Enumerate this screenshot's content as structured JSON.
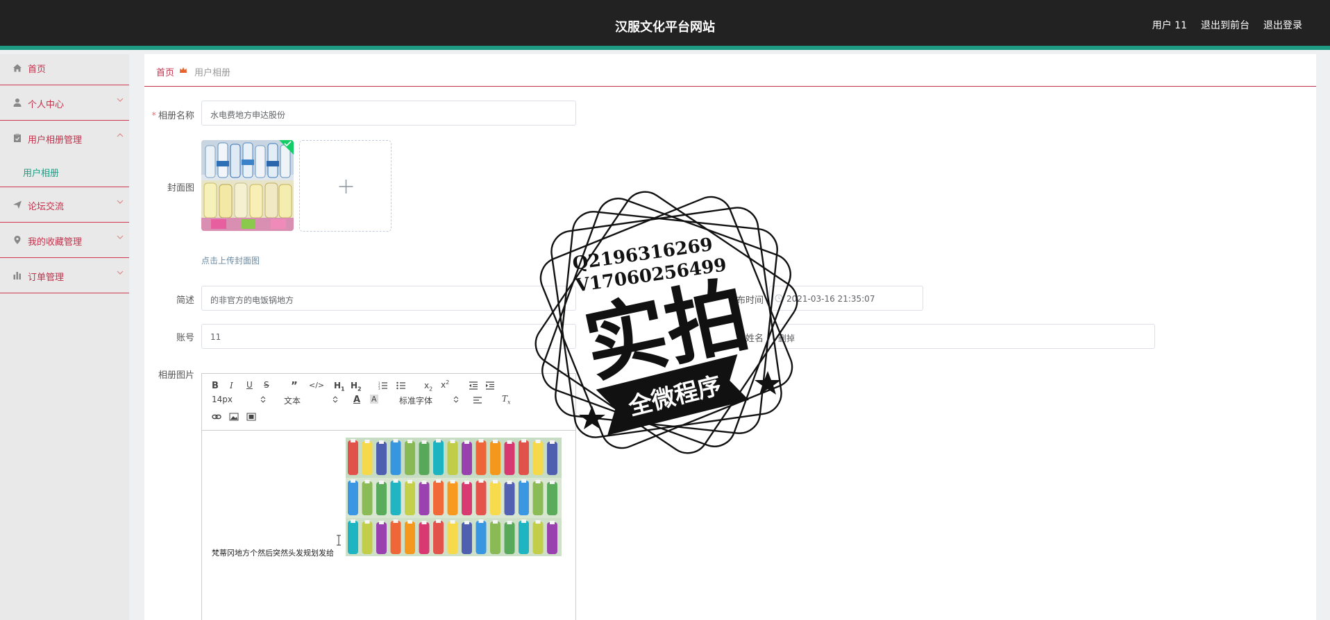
{
  "header": {
    "site_title": "汉服文化平台网站",
    "user": "用户 11",
    "back_front": "退出到前台",
    "logout": "退出登录"
  },
  "sidebar": {
    "items": [
      {
        "label": "首页",
        "icon": "home-icon"
      },
      {
        "label": "个人中心",
        "icon": "user-icon"
      },
      {
        "label": "用户相册管理",
        "icon": "clipboard-icon"
      },
      {
        "label": "论坛交流",
        "icon": "send-icon"
      },
      {
        "label": "我的收藏管理",
        "icon": "location-icon"
      },
      {
        "label": "订单管理",
        "icon": "bar-chart-icon"
      }
    ],
    "sub_item": "用户相册"
  },
  "breadcrumb": {
    "home": "首页",
    "current": "用户相册"
  },
  "form": {
    "album_name_label": "相册名称",
    "album_name_value": "水电费地方申达股份",
    "cover_label": "封面图",
    "upload_hint": "点击上传封面图",
    "desc_label": "简述",
    "desc_value": "的非官方的电饭锅地方",
    "publish_time_label": "布时间",
    "publish_time_value": "2021-03-16 21:35:07",
    "account_label": "账号",
    "account_value": "11",
    "name_label": "姓名",
    "name_value": "删掉",
    "images_label": "相册图片"
  },
  "editor": {
    "font_size": "14px",
    "text_type": "文本",
    "font_family": "标准字体",
    "content_text": "梵蒂冈地方个然后突然头发规划发给"
  },
  "watermark": {
    "line1": "Q2196316269",
    "line2": "V17060256499",
    "big": "实拍",
    "banner": "全微程序"
  },
  "colors": {
    "accent_red": "#c4304a",
    "accent_green": "#1e9b83",
    "header_bg": "#222222"
  }
}
